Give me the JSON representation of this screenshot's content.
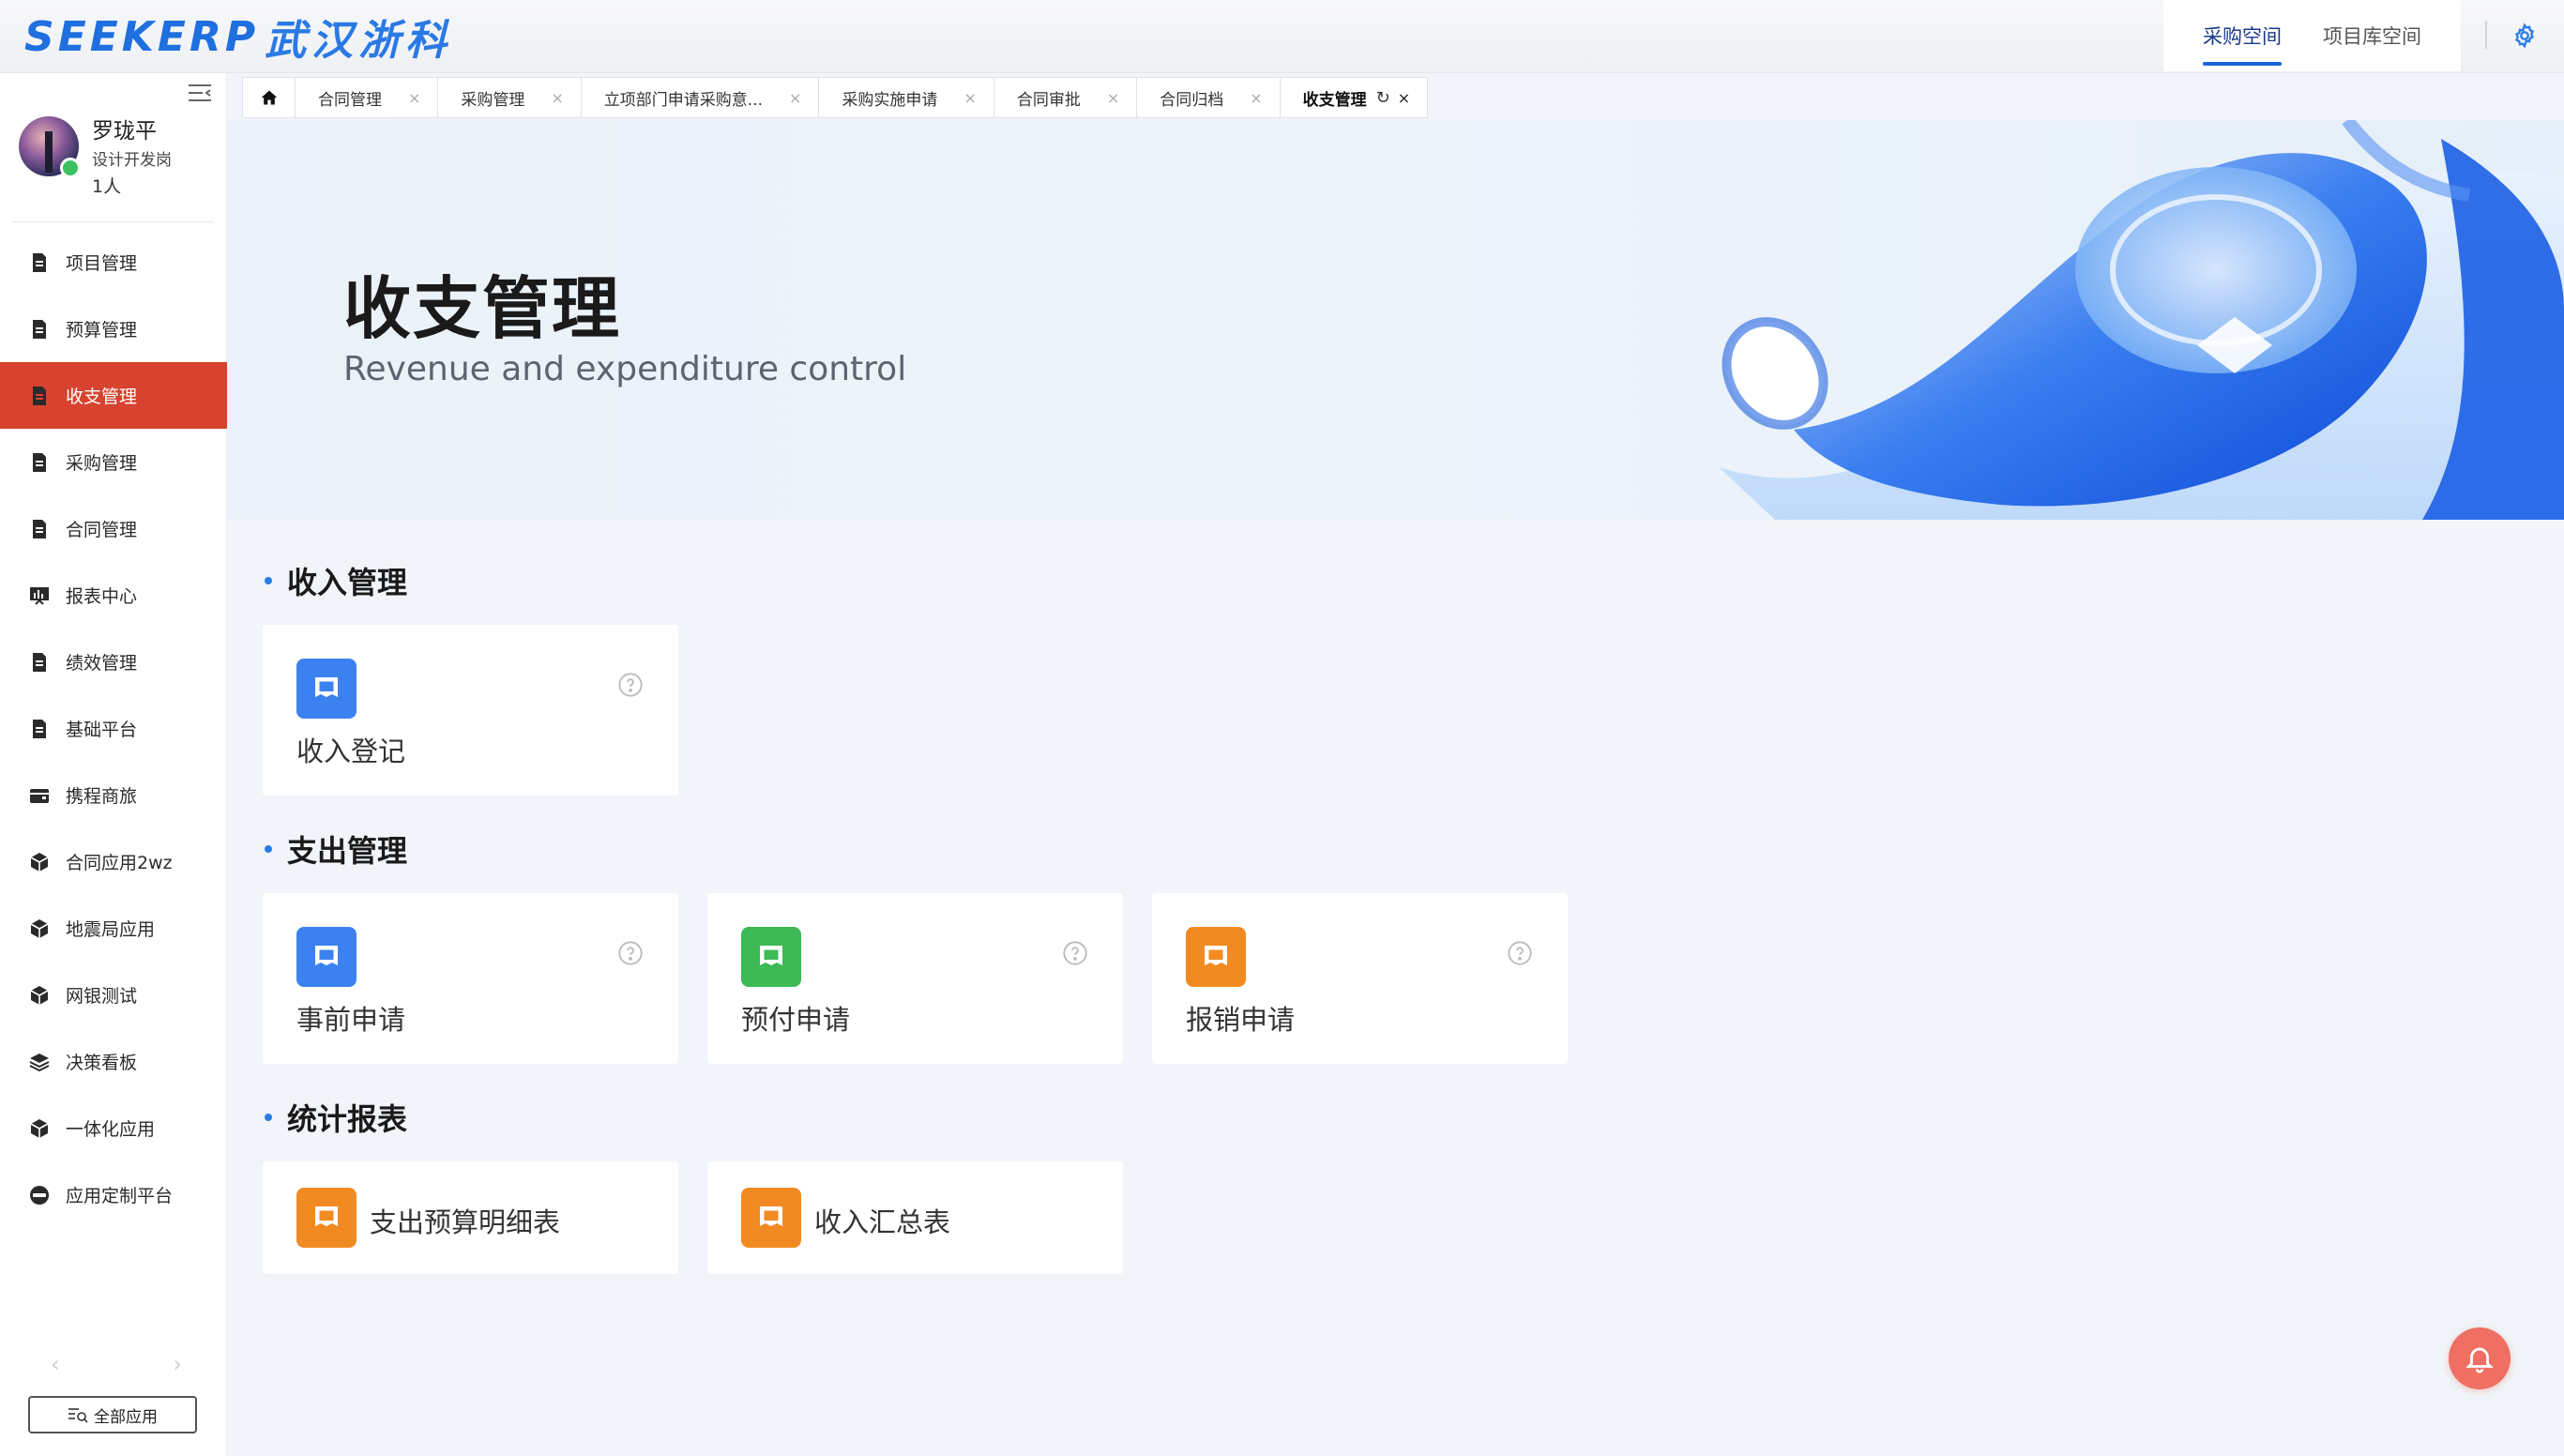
{
  "header": {
    "logo_en": "SEEKERP",
    "logo_cn": "武汉浙科",
    "space_tabs": [
      {
        "label": "采购空间",
        "active": true
      },
      {
        "label": "项目库空间",
        "active": false
      }
    ],
    "settings_icon": "gear-icon"
  },
  "sidebar": {
    "user": {
      "name": "罗珑平",
      "role": "设计开发岗",
      "count": "1人"
    },
    "menu": [
      {
        "label": "项目管理",
        "icon": "document-icon",
        "active": false
      },
      {
        "label": "预算管理",
        "icon": "document-icon",
        "active": false
      },
      {
        "label": "收支管理",
        "icon": "document-icon",
        "active": true
      },
      {
        "label": "采购管理",
        "icon": "document-icon",
        "active": false
      },
      {
        "label": "合同管理",
        "icon": "document-icon",
        "active": false
      },
      {
        "label": "报表中心",
        "icon": "chart-board-icon",
        "active": false
      },
      {
        "label": "绩效管理",
        "icon": "document-icon",
        "active": false
      },
      {
        "label": "基础平台",
        "icon": "document-icon",
        "active": false
      },
      {
        "label": "携程商旅",
        "icon": "wallet-icon",
        "active": false
      },
      {
        "label": "合同应用2wz",
        "icon": "cube-icon",
        "active": false
      },
      {
        "label": "地震局应用",
        "icon": "cube-icon",
        "active": false
      },
      {
        "label": "网银测试",
        "icon": "cube-icon",
        "active": false
      },
      {
        "label": "决策看板",
        "icon": "layers-icon",
        "active": false
      },
      {
        "label": "一体化应用",
        "icon": "cube-icon",
        "active": false
      },
      {
        "label": "应用定制平台",
        "icon": "cap-icon",
        "active": false
      }
    ],
    "all_apps_label": "全部应用"
  },
  "tabs": [
    {
      "label": "合同管理"
    },
    {
      "label": "采购管理"
    },
    {
      "label": "立项部门申请采购意..."
    },
    {
      "label": "采购实施申请"
    },
    {
      "label": "合同审批"
    },
    {
      "label": "合同归档"
    },
    {
      "label": "收支管理",
      "active": true
    }
  ],
  "banner": {
    "title": "收支管理",
    "subtitle": "Revenue and expenditure control"
  },
  "sections": [
    {
      "title": "收入管理",
      "cards": [
        {
          "label": "收入登记",
          "color": "#3b82f0"
        }
      ]
    },
    {
      "title": "支出管理",
      "cards": [
        {
          "label": "事前申请",
          "color": "#3b82f0"
        },
        {
          "label": "预付申请",
          "color": "#3dba55"
        },
        {
          "label": "报销申请",
          "color": "#f28a22"
        }
      ]
    },
    {
      "title": "统计报表",
      "cards": [
        {
          "label": "支出预算明细表",
          "color": "#f28a22"
        },
        {
          "label": "收入汇总表",
          "color": "#f28a22"
        }
      ]
    }
  ],
  "colors": {
    "accent": "#d7432f",
    "primary": "#1a63d6",
    "bell": "#ef6f62"
  }
}
